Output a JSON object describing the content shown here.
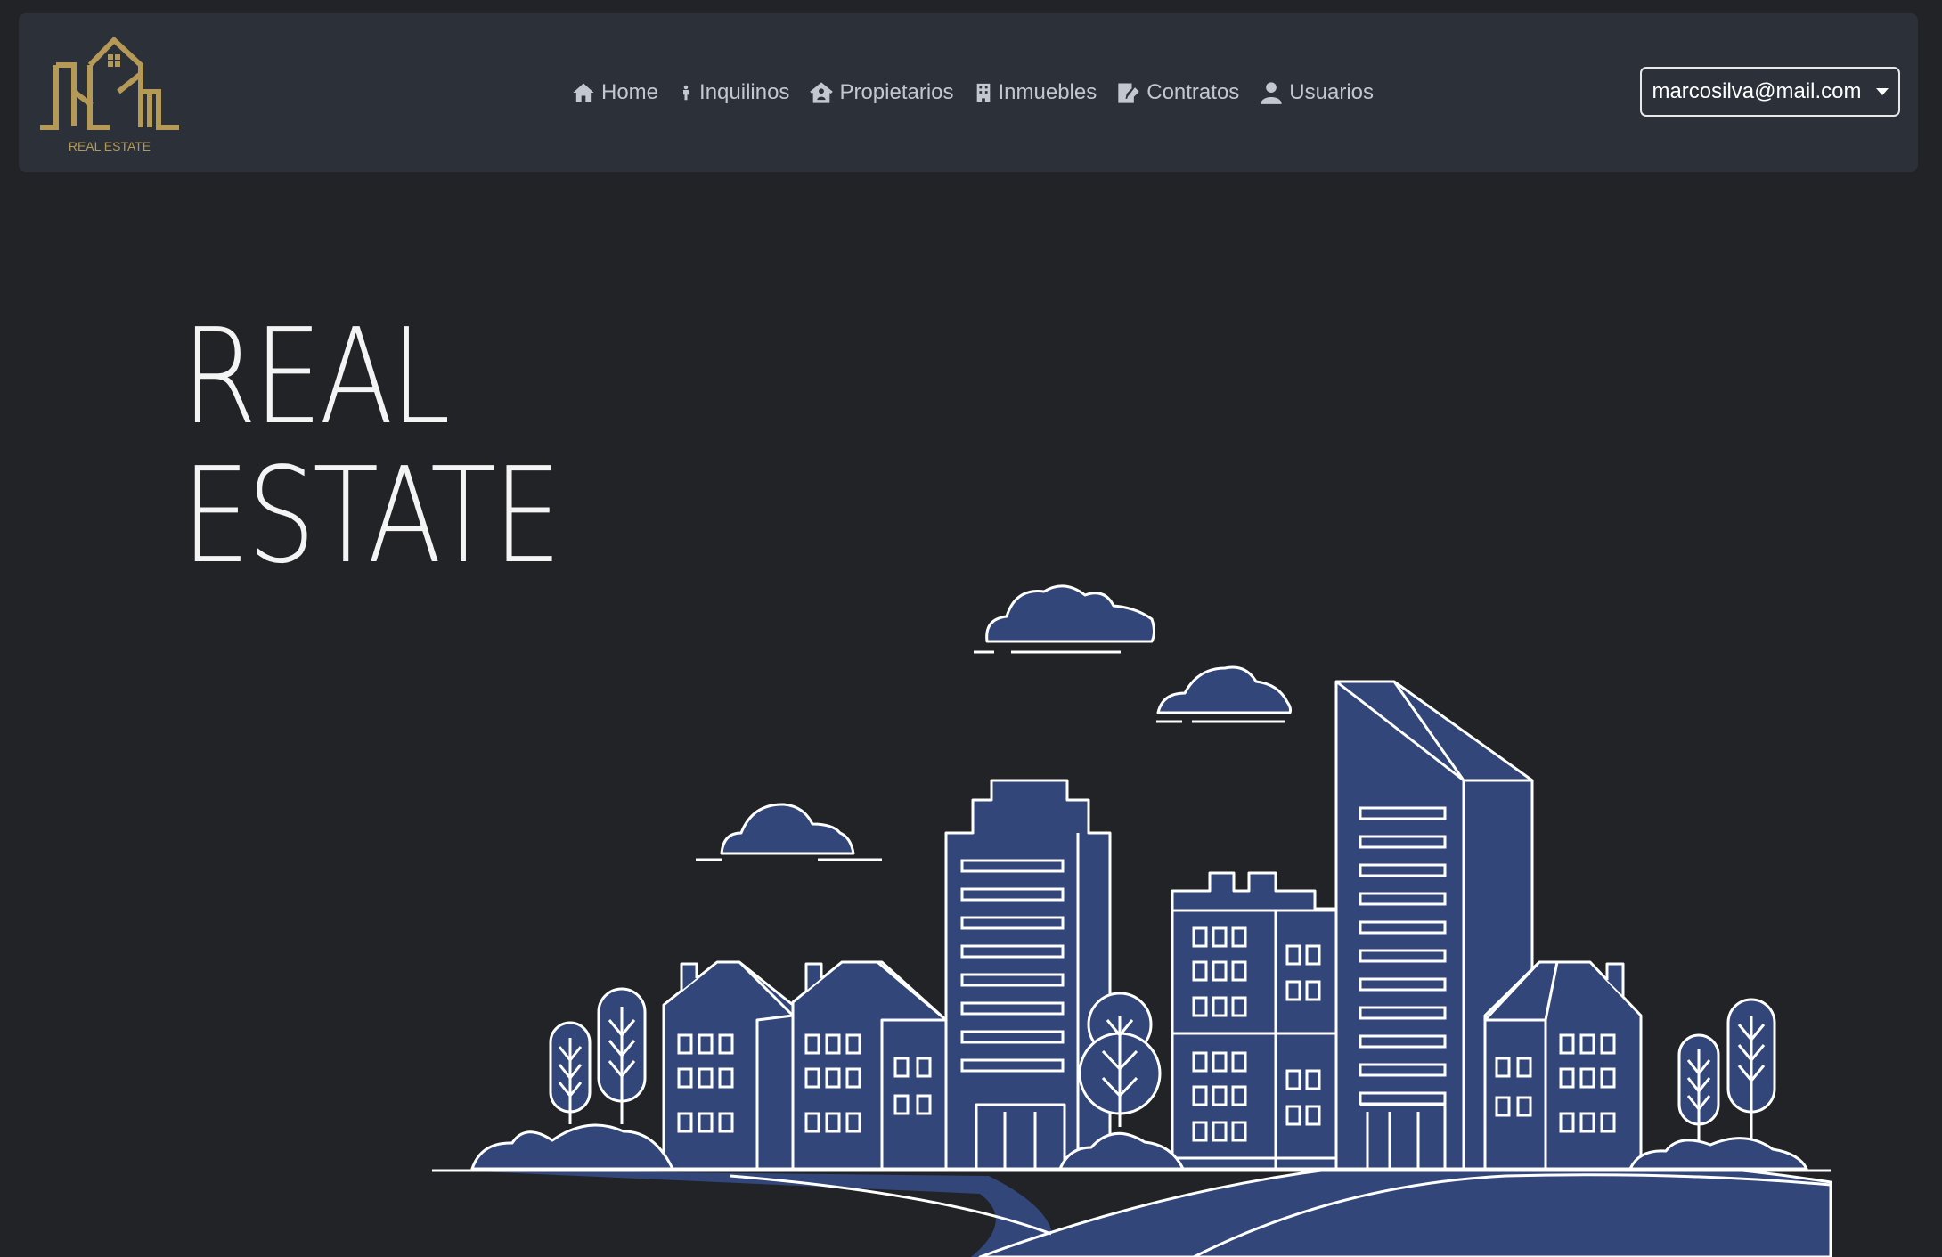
{
  "brand": {
    "logo_text": "REAL ESTATE"
  },
  "nav": {
    "items": [
      {
        "label": "Home",
        "icon": "home-icon"
      },
      {
        "label": "Inquilinos",
        "icon": "person-icon"
      },
      {
        "label": "Propietarios",
        "icon": "house-user-icon"
      },
      {
        "label": "Inmuebles",
        "icon": "building-icon"
      },
      {
        "label": "Contratos",
        "icon": "contract-icon"
      },
      {
        "label": "Usuarios",
        "icon": "user-icon"
      }
    ]
  },
  "user": {
    "email": "marcosilva@mail.com"
  },
  "hero": {
    "line1": "REAL",
    "line2": "ESTATE"
  },
  "colors": {
    "background": "#212327",
    "navbar": "#2c3038",
    "gold": "#b59a57",
    "building": "#33467a",
    "outline": "#ffffff"
  }
}
